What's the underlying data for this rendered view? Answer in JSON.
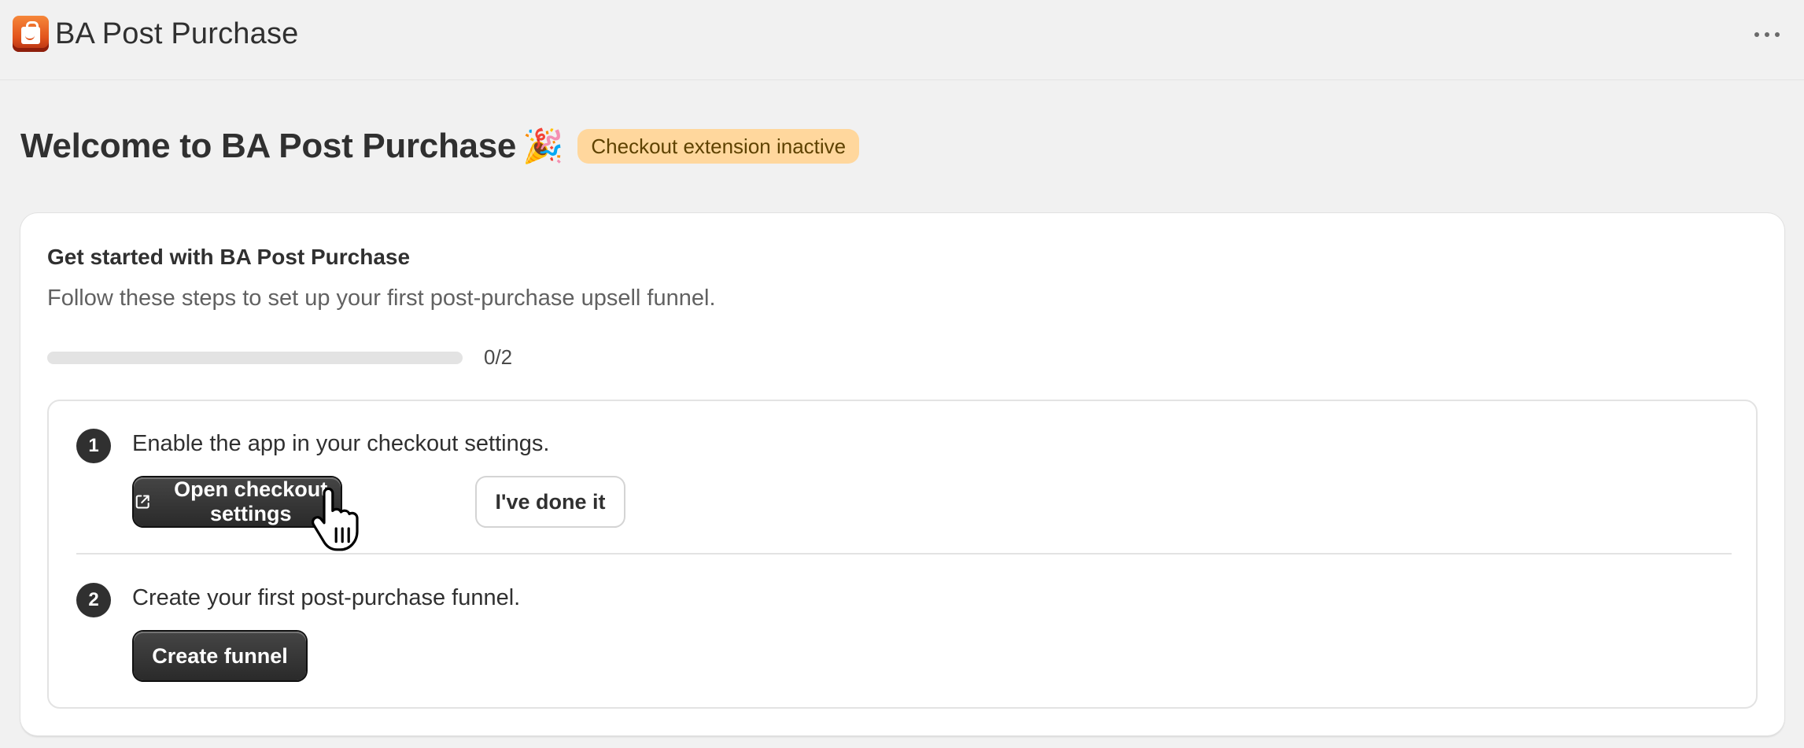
{
  "header": {
    "app_title": "BA Post Purchase",
    "logo_icon": "shopping-bag-icon",
    "more_icon": "ellipsis-icon"
  },
  "page": {
    "title": "Welcome to BA Post Purchase",
    "title_emoji": "🎉",
    "status_badge": "Checkout extension inactive"
  },
  "card": {
    "title": "Get started with BA Post Purchase",
    "subtitle": "Follow these steps to set up your first post-purchase upsell funnel.",
    "progress": {
      "completed": 0,
      "total": 2,
      "label": "0/2"
    },
    "steps": [
      {
        "number": "1",
        "text": "Enable the app in your checkout settings.",
        "primary_button": "Open checkout settings",
        "primary_icon": "external-link-icon",
        "secondary_button": "I've done it"
      },
      {
        "number": "2",
        "text": "Create your first post-purchase funnel.",
        "primary_button": "Create funnel"
      }
    ]
  },
  "colors": {
    "background": "#f1f1f1",
    "badge_bg": "#ffd79d",
    "badge_text": "#5e4200",
    "primary_button": "#303030"
  }
}
